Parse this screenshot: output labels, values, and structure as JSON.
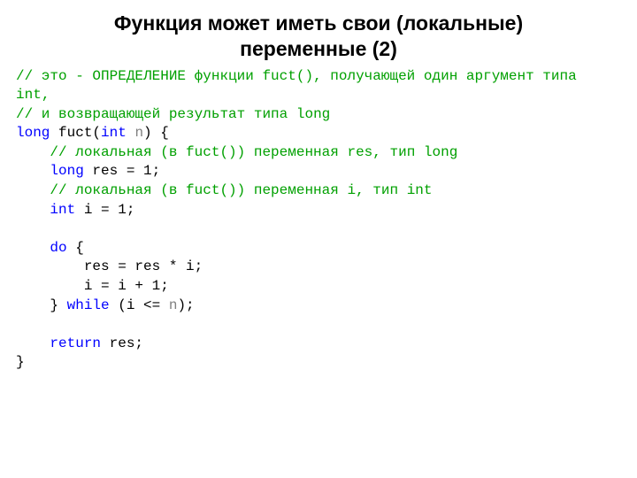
{
  "title": "Функция может иметь свои (локальные) переменные (2)",
  "code": {
    "c1a": "// это - ОПРЕДЕЛЕНИЕ функции ",
    "c1b": "fuct()",
    "c1c": ", получающей один аргумент типа ",
    "c1d": "int",
    "c1e": ",",
    "c2a": "// и возвращающей результат типа ",
    "c2b": "long",
    "l3_kw": "long",
    "l3_t1": " fuct(",
    "l3_kw2": "int",
    "l3_sp": " ",
    "l3_id": "n",
    "l3_t2": ") {",
    "l4_ind": "    ",
    "l4_c1": "// локальная (в ",
    "l4_c2": "fuct()",
    "l4_c3": ") переменная ",
    "l4_c4": "res",
    "l4_c5": ", тип ",
    "l4_c6": "long",
    "l5_ind": "    ",
    "l5_kw": "long",
    "l5_t": " res = 1;",
    "l6_ind": "    ",
    "l6_c1": "// локальная (в ",
    "l6_c2": "fuct()",
    "l6_c3": ") переменная ",
    "l6_c4": "i",
    "l6_c5": ", тип ",
    "l6_c6": "int",
    "l7_ind": "    ",
    "l7_kw": "int",
    "l7_t": " i = 1;",
    "blank": "",
    "l9_ind": "    ",
    "l9_kw": "do",
    "l9_t": " {",
    "l10_ind": "        ",
    "l10_t": "res = res * i;",
    "l11_ind": "        ",
    "l11_t": "i = i + 1;",
    "l12_ind": "    ",
    "l12_t1": "} ",
    "l12_kw": "while",
    "l12_t2": " (i <= ",
    "l12_id": "n",
    "l12_t3": ");",
    "l14_ind": "    ",
    "l14_kw": "return",
    "l14_t": " res;",
    "l15_t": "}"
  }
}
